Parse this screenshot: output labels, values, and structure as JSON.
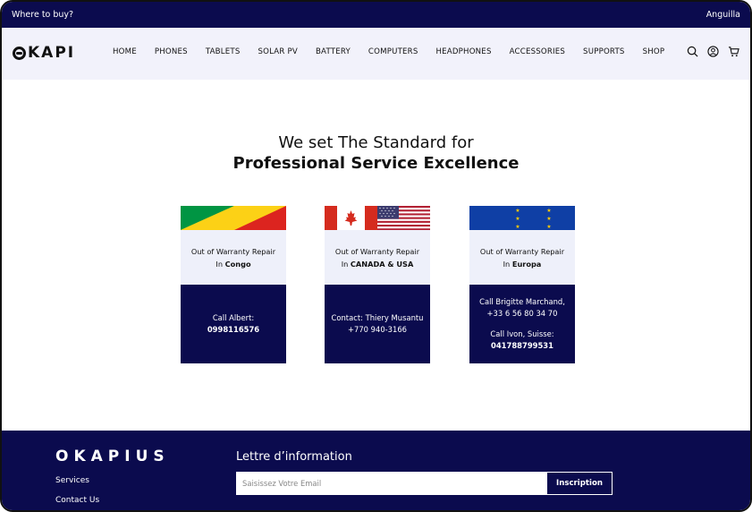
{
  "topbar": {
    "left_link": "Where to buy?",
    "region": "Anguilla"
  },
  "brand": {
    "logo_text": "KAPI"
  },
  "nav": {
    "items": [
      "HOME",
      "PHONES",
      "TABLETS",
      "SOLAR PV",
      "BATTERY",
      "COMPUTERS",
      "HEADPHONES",
      "ACCESSORIES",
      "SUPPORTS",
      "SHOP"
    ],
    "icons": [
      "search-icon",
      "user-icon",
      "cart-icon"
    ]
  },
  "hero": {
    "line1": "We set The Standard for",
    "line2": "Professional Service Excellence"
  },
  "cards": [
    {
      "flag": "congo-flag",
      "title": "Out of Warranty Repair",
      "location_prefix": "In ",
      "location": "Congo",
      "contacts": [
        {
          "label": "Call Albert:",
          "number": "0998116576",
          "number_bold": true
        }
      ]
    },
    {
      "flag": "canada-usa-flags",
      "title": "Out of Warranty Repair",
      "location_prefix": "In ",
      "location": "CANADA & USA",
      "contacts": [
        {
          "label": "Contact: Thiery Musantu",
          "number": "+770 940-3166",
          "number_bold": false
        }
      ]
    },
    {
      "flag": "eu-flag",
      "title": "Out of Warranty Repair",
      "location_prefix": "In ",
      "location": "Europa",
      "contacts": [
        {
          "label": "Call Brigitte Marchand,",
          "number": "+33 6 56 80 34 70",
          "number_bold": false
        },
        {
          "label": "Call Ivon, Suisse:",
          "number": "041788799531",
          "number_bold": true
        }
      ]
    }
  ],
  "footer": {
    "logo": "OKAPIUS",
    "links": [
      "Services",
      "Contact Us"
    ],
    "newsletter_title": "Lettre d’information",
    "email_placeholder": "Saisissez Votre Email",
    "subscribe_label": "Inscription"
  },
  "colors": {
    "navy": "#0b0b4e",
    "nav_bg": "#f2f2fb",
    "card_bg": "#eef0fa"
  }
}
